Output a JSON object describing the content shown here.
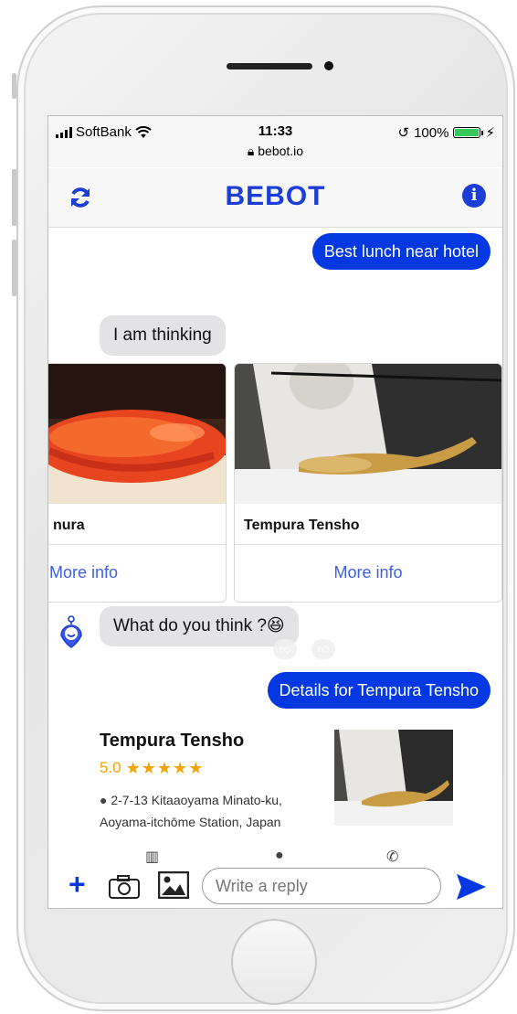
{
  "status_bar": {
    "carrier": "SoftBank",
    "time": "11:33",
    "url": "bebot.io",
    "battery": "100%"
  },
  "header": {
    "logo": "BEBOT",
    "refresh_icon": "refresh-icon",
    "info_icon": "info-icon"
  },
  "chat": {
    "user_message_1": "Best lunch near hotel",
    "bot_message_1": "I am thinking",
    "cards": [
      {
        "title": "nura",
        "link": "More info"
      },
      {
        "title": "Tempura Tensho",
        "link": "More info"
      }
    ],
    "bot_message_2": "What do you think ?😆",
    "user_message_2": "Details for Tempura Tensho"
  },
  "detail": {
    "name": "Tempura Tensho",
    "rating": "5.0",
    "stars": "★★★★★",
    "address_line_1": "2-7-13 Kitaaoyama Minato-ku,",
    "address_line_2": "Aoyama-itchōme Station, Japan"
  },
  "composer": {
    "placeholder": "Write a reply"
  },
  "colors": {
    "brand": "#0438e0",
    "logo": "#1c3ed6",
    "link": "#3e5fe6",
    "star": "#f5a300",
    "bot_bubble": "#e3e3e6"
  }
}
